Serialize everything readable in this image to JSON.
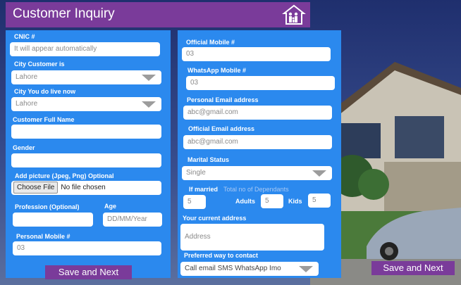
{
  "header": {
    "title": "Customer Inquiry",
    "icon": "family-house-icon"
  },
  "left_form": {
    "cnic": {
      "label": "CNIC #",
      "placeholder": "It will appear automatically"
    },
    "city_customer": {
      "label": "City Customer is",
      "value": "Lahore"
    },
    "city_live": {
      "label": "City You do live now",
      "value": "Lahore"
    },
    "full_name": {
      "label": "Customer Full Name",
      "value": ""
    },
    "gender": {
      "label": "Gender",
      "value": ""
    },
    "picture": {
      "label": "Add picture (Jpeg, Png) Optional",
      "button": "Choose File",
      "status": "No file chosen"
    },
    "profession": {
      "label": "Profession (Optional)",
      "value": ""
    },
    "age": {
      "label": "Age",
      "placeholder": "DD/MM/Year"
    },
    "personal_mobile": {
      "label": "Personal Mobile #",
      "placeholder": "03"
    },
    "save_button": "Save and Next"
  },
  "right_form": {
    "official_mobile": {
      "label": "Official Mobile #",
      "placeholder": "03"
    },
    "whatsapp_mobile": {
      "label": "WhatsApp Mobile #",
      "placeholder": "03"
    },
    "personal_email": {
      "label": "Personal Email address",
      "placeholder": "abc@gmail.com"
    },
    "official_email": {
      "label": "Official Email address",
      "placeholder": "abc@gmail.com"
    },
    "marital_status": {
      "label": "Marital Status",
      "value": "Single"
    },
    "dependants": {
      "label": "If married",
      "sublabel": "Total no of Dependants",
      "total": "5",
      "adults_label": "Adults",
      "adults": "5",
      "kids_label": "Kids",
      "kids": "5"
    },
    "address": {
      "label": "Your current address",
      "placeholder": "Address"
    },
    "contact_pref": {
      "label": "Preferred way to contact",
      "value": "Call email SMS WhatsApp Imo"
    }
  },
  "outer_save_button": "Save and Next",
  "colors": {
    "accent_purple": "#7a3b9a",
    "panel_blue": "#2b89ee"
  }
}
